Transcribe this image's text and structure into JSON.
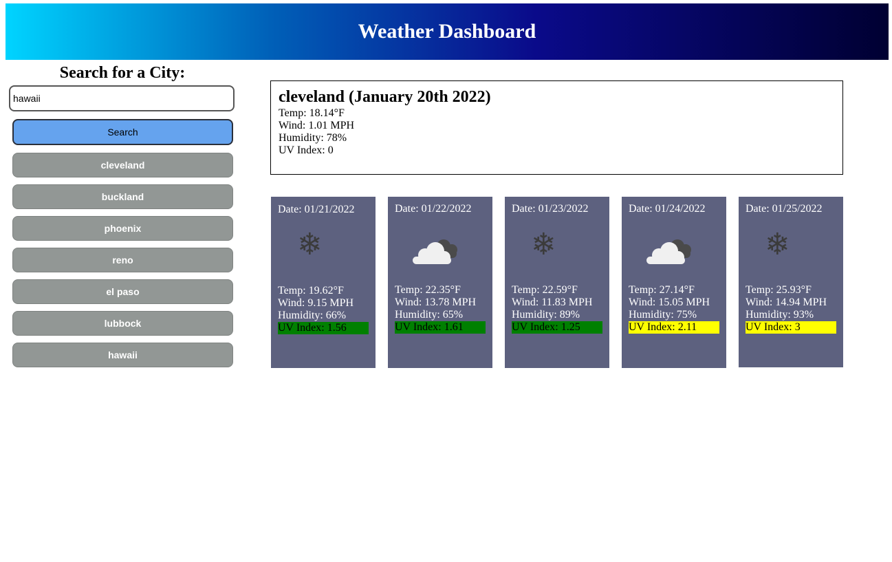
{
  "header": {
    "title": "Weather Dashboard"
  },
  "sidebar": {
    "heading": "Search for a City:",
    "search_value": "hawaii",
    "search_button": "Search",
    "history": [
      "cleveland",
      "buckland",
      "phoenix",
      "reno",
      "el paso",
      "lubbock",
      "hawaii"
    ]
  },
  "current": {
    "title": "cleveland (January 20th 2022)",
    "temp": "Temp: 18.14°F",
    "wind": "Wind: 1.01 MPH",
    "humidity": "Humidity: 78%",
    "uv": "UV Index: 0"
  },
  "forecast": [
    {
      "date": "Date: 01/21/2022",
      "icon": "snowflake-icon",
      "temp": "Temp: 19.62°F",
      "wind": "Wind: 9.15 MPH",
      "humidity": "Humidity: 66%",
      "uv": "UV Index: 1.56",
      "uv_color": "#008000"
    },
    {
      "date": "Date: 01/22/2022",
      "icon": "cloud-icon",
      "temp": "Temp: 22.35°F",
      "wind": "Wind: 13.78 MPH",
      "humidity": "Humidity: 65%",
      "uv": "UV Index: 1.61",
      "uv_color": "#008000"
    },
    {
      "date": "Date: 01/23/2022",
      "icon": "snowflake-icon",
      "temp": "Temp: 22.59°F",
      "wind": "Wind: 11.83 MPH",
      "humidity": "Humidity: 89%",
      "uv": "UV Index: 1.25",
      "uv_color": "#008000"
    },
    {
      "date": "Date: 01/24/2022",
      "icon": "cloud-icon",
      "temp": "Temp: 27.14°F",
      "wind": "Wind: 15.05 MPH",
      "humidity": "Humidity: 75%",
      "uv": "UV Index: 2.11",
      "uv_color": "#ffff00"
    },
    {
      "date": "Date: 01/25/2022",
      "icon": "snowflake-icon",
      "temp": "Temp: 25.93°F",
      "wind": "Wind: 14.94 MPH",
      "humidity": "Humidity: 93%",
      "uv": "UV Index: 3",
      "uv_color": "#ffff00"
    }
  ],
  "colors": {
    "card_bg": "#5d617f",
    "search_button": "#65a3ee",
    "history_button": "#929795"
  }
}
